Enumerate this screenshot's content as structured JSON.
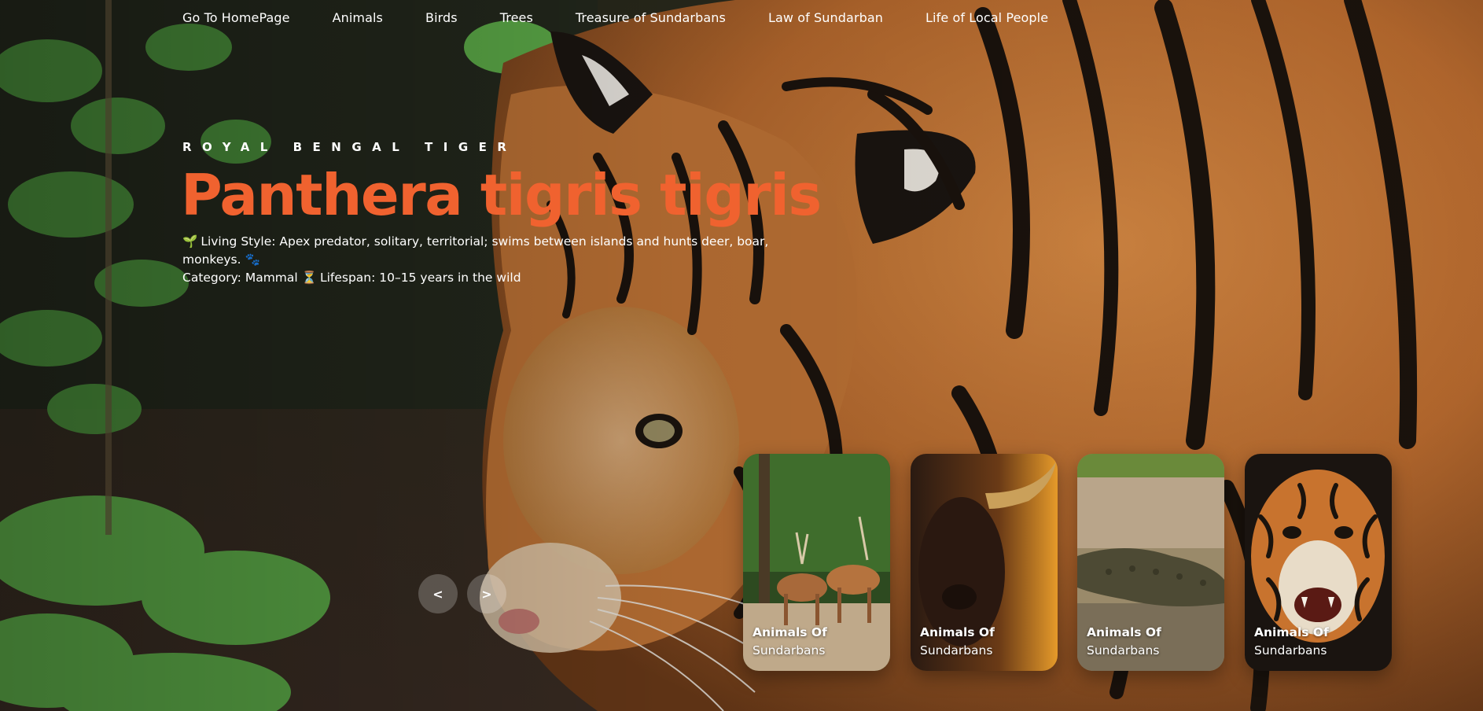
{
  "nav": {
    "links": [
      "Go To HomePage",
      "Animals",
      "Birds",
      "Trees",
      "Treasure of Sundarbans",
      "Law of Sundarban",
      "Life of Local People"
    ]
  },
  "hero": {
    "eyebrow": "ROYAL BENGAL TIGER",
    "title": "Panthera tigris tigris",
    "line1_icon": "🌱",
    "line1_text": "Living Style: Apex predator, solitary, territorial; swims between islands and hunts deer, boar, monkeys.",
    "line1_end_icon": "🐾",
    "category": "Category: Mammal",
    "lifespan_icon": "⏳",
    "lifespan": "Lifespan: 10–15 years in the wild"
  },
  "slider": {
    "prev_glyph": "<",
    "next_glyph": ">"
  },
  "cards": [
    {
      "title": "Animals Of",
      "subtitle": "Sundarbans",
      "image": "spotted-deer"
    },
    {
      "title": "Animals Of",
      "subtitle": "Sundarbans",
      "image": "wild-buffalo"
    },
    {
      "title": "Animals Of",
      "subtitle": "Sundarbans",
      "image": "crocodile"
    },
    {
      "title": "Animals Of",
      "subtitle": "Sundarbans",
      "image": "roaring-tiger"
    }
  ],
  "colors": {
    "accent": "#f0622f",
    "tiger_orange": "#c97a3a",
    "foliage": "#3f8a36",
    "ground": "#3a2c22"
  }
}
